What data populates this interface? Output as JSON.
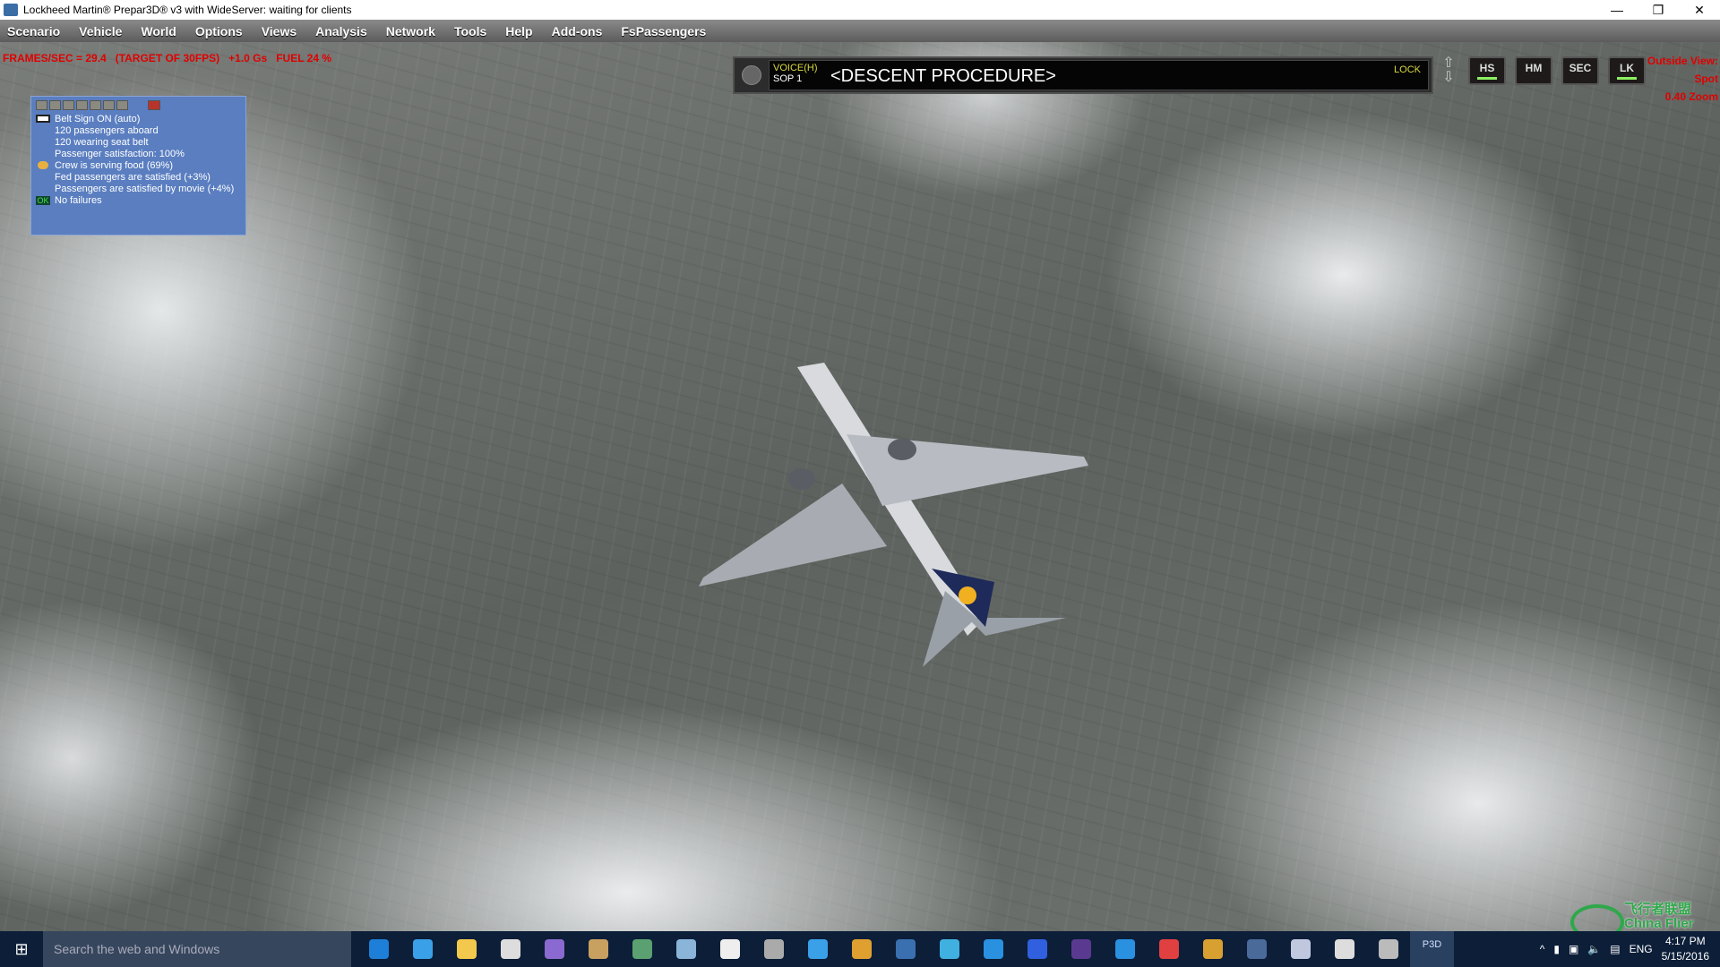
{
  "window": {
    "title": "Lockheed Martin® Prepar3D® v3 with WideServer: waiting for clients",
    "controls": [
      "—",
      "❐",
      "✕"
    ]
  },
  "menu": [
    "Scenario",
    "Vehicle",
    "World",
    "Options",
    "Views",
    "Analysis",
    "Network",
    "Tools",
    "Help",
    "Add-ons",
    "FsPassengers"
  ],
  "status_line": "FRAMES/SEC = 29.4   (TARGET OF 30FPS)   +1.0 Gs   FUEL 24 %",
  "fspassengers": {
    "lines": [
      {
        "icon": "seatbelt-icon",
        "text": "Belt Sign ON (auto)"
      },
      {
        "icon": "",
        "text": "120 passengers aboard"
      },
      {
        "icon": "",
        "text": "120 wearing seat belt"
      },
      {
        "icon": "",
        "text": "Passenger satisfaction: 100%"
      },
      {
        "icon": "food-icon",
        "text": "Crew is serving food (69%)"
      },
      {
        "icon": "",
        "text": "Fed passengers are satisfied (+3%)"
      },
      {
        "icon": "",
        "text": "Passengers are satisfied by movie (+4%)"
      },
      {
        "icon": "ok-icon",
        "text": "No failures"
      }
    ],
    "ok_label": "OK"
  },
  "voice_panel": {
    "mode": "VOICE(H)",
    "sop": "SOP 1",
    "message": "<DESCENT PROCEDURE>",
    "lock": "LOCK",
    "buttons": [
      {
        "label": "HS",
        "on": true
      },
      {
        "label": "HM",
        "on": false
      },
      {
        "label": "SEC",
        "on": false
      },
      {
        "label": "LK",
        "on": true
      }
    ]
  },
  "view_info": [
    "Outside View:",
    "Spot",
    "0.40 Zoom"
  ],
  "taskbar": {
    "search_placeholder": "Search the web and Windows",
    "apps": [
      {
        "name": "edge",
        "color": "#1e7fd8"
      },
      {
        "name": "internet-explorer",
        "color": "#3aa0e8"
      },
      {
        "name": "file-explorer",
        "color": "#f2c94c"
      },
      {
        "name": "store",
        "color": "#dddddd"
      },
      {
        "name": "app-purple",
        "color": "#8a6ad0"
      },
      {
        "name": "paint",
        "color": "#c8a060"
      },
      {
        "name": "app-green",
        "color": "#5aa070"
      },
      {
        "name": "notepad",
        "color": "#8ab4d8"
      },
      {
        "name": "calculator",
        "color": "#eeeeee"
      },
      {
        "name": "globe",
        "color": "#aaaaaa"
      },
      {
        "name": "plane-app",
        "color": "#3aa0e8"
      },
      {
        "name": "chrome",
        "color": "#e0a030"
      },
      {
        "name": "python",
        "color": "#3a70b0"
      },
      {
        "name": "app-cyan",
        "color": "#40b0e0"
      },
      {
        "name": "downloader",
        "color": "#2a90e0"
      },
      {
        "name": "thunder",
        "color": "#3060e0"
      },
      {
        "name": "app-violet",
        "color": "#5a3a90"
      },
      {
        "name": "baidu-cloud",
        "color": "#2a90e0"
      },
      {
        "name": "qq",
        "color": "#e04040"
      },
      {
        "name": "feather",
        "color": "#d8a030"
      },
      {
        "name": "cpnl",
        "color": "#4a6a9a"
      },
      {
        "name": "doc-app",
        "color": "#c0c8e0"
      },
      {
        "name": "n-app",
        "color": "#dddddd"
      },
      {
        "name": "ezca",
        "color": "#bbbbbb"
      },
      {
        "name": "p3d",
        "color": "#4a6ea5",
        "active": true,
        "label": "P3D"
      }
    ],
    "tray": {
      "lang": "ENG",
      "time": "4:17 PM",
      "date": "5/15/2016"
    }
  },
  "watermark": {
    "cn": "飞行者联盟",
    "en": "China Flier"
  }
}
